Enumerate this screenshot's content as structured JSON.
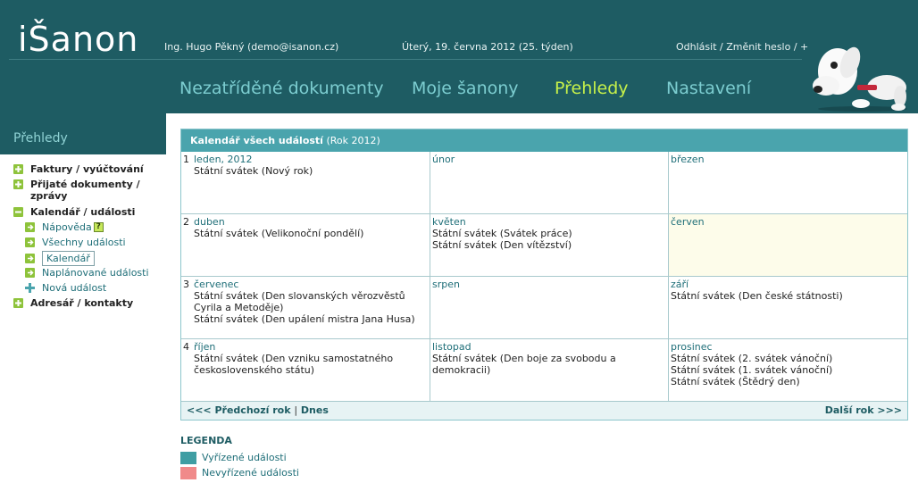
{
  "header": {
    "logo": "iŠanon",
    "user": "Ing. Hugo Pěkný (demo@isanon.cz)",
    "date": "Úterý, 19. června 2012 (25. týden)",
    "logout": "Odhlásit",
    "separator": " / ",
    "change_password": "Změnit heslo",
    "plus": "+"
  },
  "nav": {
    "items": [
      {
        "label": "Nezatříděné dokumenty"
      },
      {
        "label": "Moje šanony"
      },
      {
        "label": "Přehledy"
      },
      {
        "label": "Nastavení"
      }
    ],
    "active": "Přehledy"
  },
  "sidebar": {
    "title": "Přehledy",
    "items": [
      {
        "label": "Faktury / vyúčtování"
      },
      {
        "label": "Přijaté dokumenty / zprávy"
      },
      {
        "label": "Kalendář / události"
      },
      {
        "label": "Adresář / kontakty"
      }
    ],
    "sub_items": [
      {
        "label": "Nápověda",
        "badge": "?"
      },
      {
        "label": "Všechny události"
      },
      {
        "label": "Kalendář"
      },
      {
        "label": "Naplánované události"
      },
      {
        "label": "Nová událost"
      }
    ]
  },
  "calendar": {
    "title": "Kalendář všech událostí",
    "year_note": "(Rok 2012)",
    "quarters": [
      "1",
      "2",
      "3",
      "4"
    ],
    "months": [
      {
        "name": "leden, 2012",
        "events": [
          "Státní svátek (Nový rok)"
        ]
      },
      {
        "name": "únor",
        "events": []
      },
      {
        "name": "březen",
        "events": []
      },
      {
        "name": "duben",
        "events": [
          "Státní svátek (Velikonoční pondělí)"
        ]
      },
      {
        "name": "květen",
        "events": [
          "Státní svátek (Svátek práce)",
          "Státní svátek (Den vítězství)"
        ]
      },
      {
        "name": "červen",
        "events": []
      },
      {
        "name": "červenec",
        "events": [
          "Státní svátek (Den slovanských věrozvěstů Cyrila a Metoděje)",
          "Státní svátek (Den upálení mistra Jana Husa)"
        ]
      },
      {
        "name": "srpen",
        "events": []
      },
      {
        "name": "září",
        "events": [
          "Státní svátek (Den české státnosti)"
        ]
      },
      {
        "name": "říjen",
        "events": [
          "Státní svátek (Den vzniku samostatného československého státu)"
        ]
      },
      {
        "name": "listopad",
        "events": [
          "Státní svátek (Den boje za svobodu a demokracii)"
        ]
      },
      {
        "name": "prosinec",
        "events": [
          "Státní svátek (2. svátek vánoční)",
          "Státní svátek (1. svátek vánoční)",
          "Státní svátek (Štědrý den)"
        ]
      }
    ],
    "footer": {
      "prev": "<<< Předchozí rok",
      "sep": "|",
      "today": "Dnes",
      "next": "Další rok >>>"
    }
  },
  "legend": {
    "title": "LEGENDA",
    "items": [
      {
        "label": "Vyřízené události",
        "color": "#3f9ea3"
      },
      {
        "label": "Nevyřízené události",
        "color": "#f08a8a"
      }
    ]
  },
  "colors": {
    "header_bg": "#1e5c63",
    "nav_active": "#c6f04a",
    "nav_inactive": "#7ccdd0",
    "cal_header_bg": "#4aa4ad",
    "highlight_month_bg": "#fdfcea"
  }
}
